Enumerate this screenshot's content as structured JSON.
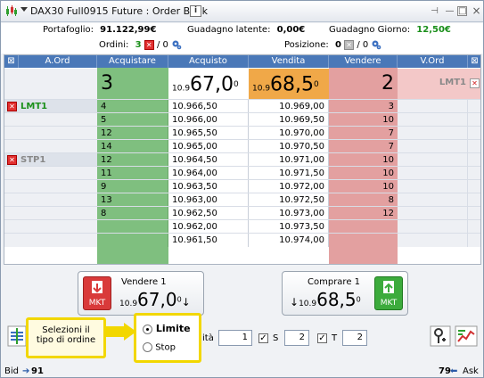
{
  "title": "DAX30 Full0915 Future : Order Book",
  "summary": {
    "portfolio_label": "Portafoglio:",
    "portfolio_value": "91.122,99€",
    "latent_label": "Guadagno latente:",
    "latent_value": "0,00€",
    "daily_label": "Guadagno Giorno:",
    "daily_value": "12,50€",
    "orders_label": "Ordini:",
    "orders_count": "3",
    "orders_sep": "/ 0",
    "position_label": "Posizione:",
    "position_count": "0",
    "position_sep": "/ 0"
  },
  "headers": {
    "corner": "⊠",
    "a_ord": "A.Ord",
    "buy_qty": "Acquistare",
    "bid": "Acquisto",
    "ask": "Vendita",
    "sell_qty": "Vendere",
    "v_ord": "V.Ord",
    "end": "⊠"
  },
  "top": {
    "buy_qty": "3",
    "bid_prefix": "10.9",
    "bid_main": "67,0",
    "bid_sup": "0",
    "ask_prefix": "10.9",
    "ask_main": "68,5",
    "ask_sup": "0",
    "sell_qty": "2",
    "sell_order": "LMT1"
  },
  "rows": [
    {
      "aord": "LMT1",
      "aord_type": "lmt",
      "buy": "4",
      "bid": "10.966,50",
      "ask": "10.969,00",
      "sell": "3"
    },
    {
      "aord": "",
      "aord_type": "",
      "buy": "5",
      "bid": "10.966,00",
      "ask": "10.969,50",
      "sell": "10"
    },
    {
      "aord": "",
      "aord_type": "",
      "buy": "12",
      "bid": "10.965,50",
      "ask": "10.970,00",
      "sell": "7"
    },
    {
      "aord": "",
      "aord_type": "",
      "buy": "14",
      "bid": "10.965,00",
      "ask": "10.970,50",
      "sell": "7"
    },
    {
      "aord": "STP1",
      "aord_type": "stp",
      "buy": "12",
      "bid": "10.964,50",
      "ask": "10.971,00",
      "sell": "10"
    },
    {
      "aord": "",
      "aord_type": "",
      "buy": "11",
      "bid": "10.964,00",
      "ask": "10.971,50",
      "sell": "10"
    },
    {
      "aord": "",
      "aord_type": "",
      "buy": "9",
      "bid": "10.963,50",
      "ask": "10.972,00",
      "sell": "10"
    },
    {
      "aord": "",
      "aord_type": "",
      "buy": "13",
      "bid": "10.963,00",
      "ask": "10.972,50",
      "sell": "8"
    },
    {
      "aord": "",
      "aord_type": "",
      "buy": "8",
      "bid": "10.962,50",
      "ask": "10.973,00",
      "sell": "12"
    },
    {
      "aord": "",
      "aord_type": "",
      "buy": "",
      "bid": "10.962,00",
      "ask": "10.973,50",
      "sell": ""
    },
    {
      "aord": "",
      "aord_type": "",
      "buy": "",
      "bid": "10.961,50",
      "ask": "10.974,00",
      "sell": ""
    }
  ],
  "sell_button": {
    "label": "Vendere 1",
    "prefix": "10.9",
    "main": "67,0",
    "sup": "0",
    "mkt": "MKT"
  },
  "buy_button": {
    "label": "Comprare 1",
    "prefix": "10.9",
    "main": "68,5",
    "sup": "0",
    "mkt": "MKT"
  },
  "callout": {
    "line1": "Selezioni il",
    "line2": "tipo di ordine"
  },
  "order_type": {
    "limit": "Limite",
    "stop": "Stop",
    "qty_label_partial": "ità"
  },
  "inputs": {
    "qty": "1",
    "s_label": "S",
    "s_value": "2",
    "t_label": "T",
    "t_value": "2"
  },
  "status": {
    "bid_label": "Bid",
    "bid_value": "91",
    "ask_value": "79",
    "ask_label": "Ask"
  },
  "colors": {
    "header": "#4a78b8",
    "buy_col": "#7fbf7f",
    "sell_col": "#e3a0a0",
    "ask_top": "#f0a848",
    "green_text": "#1a8f1a",
    "callout_border": "#f2d700"
  }
}
